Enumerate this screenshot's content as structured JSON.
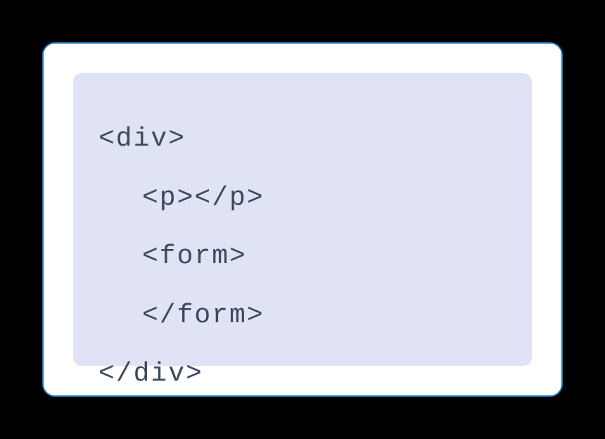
{
  "code": {
    "lines": [
      {
        "text": "<div>",
        "indent": false
      },
      {
        "text": "<p></p>",
        "indent": true
      },
      {
        "text": "<form>",
        "indent": true
      },
      {
        "text": "</form>",
        "indent": true
      },
      {
        "text": "</div>",
        "indent": false
      }
    ]
  }
}
